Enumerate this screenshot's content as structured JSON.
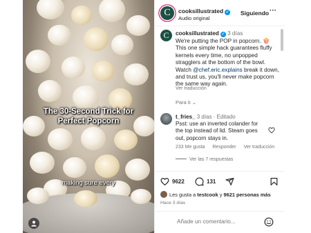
{
  "video": {
    "title": "The 30-Second Trick for Perfect Popcorn",
    "caption": "making sure every"
  },
  "header": {
    "username": "cooksillustrated",
    "subtitle": "Audio original",
    "follow_label": "Siguiendo",
    "more_label": "···",
    "avatar_letter": "C"
  },
  "caption": {
    "username": "cooksillustrated",
    "time": "3 días",
    "text_before": "We're putting the POP in popcorn. 🍿 This one simple hack guarantees fluffy kernels every time, no unpopped stragglers at the bottom of the bowl. Watch ",
    "mention": "@chef.eric.explains",
    "text_after": " break it down, and trust us, you'll never make popcorn the same way again.",
    "translate": "Ver traducción",
    "for_you": "Para ti ⌄"
  },
  "comment": {
    "username": "t_fries_",
    "time": "3 días",
    "edited": "Editado",
    "text": "Psst: use an inverted colander for the top instead of lid. Steam goes out, popcorn stays in.",
    "likes": "233 Me gusta",
    "reply": "Responder",
    "translate": "Ver traducción",
    "view_replies": "Ver las 7 respuestas"
  },
  "actions": {
    "like_count": "9622",
    "comment_count": "131",
    "likes_prefix": "Les gusta a ",
    "likes_user": "testcook",
    "likes_and": " y ",
    "likes_others": "9621 personas más",
    "ago": "Hace 3 días"
  },
  "add_comment": {
    "placeholder": "Añade un comentario..."
  },
  "colors": {
    "brand_green": "#1a5142",
    "verified_blue": "#0095f6",
    "story_ring": "#d82b7e"
  }
}
